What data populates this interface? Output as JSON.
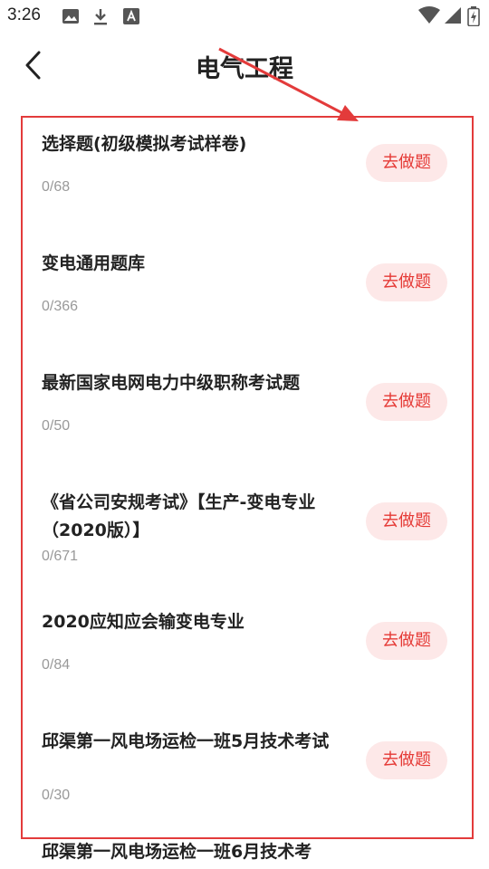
{
  "status_bar": {
    "time": "3:26",
    "icons": [
      "image-icon",
      "download-icon",
      "font-a-icon"
    ],
    "right_icons": [
      "wifi-icon",
      "signal-icon",
      "battery-icon"
    ]
  },
  "header": {
    "title": "电气工程",
    "back_icon": "chevron-left-icon"
  },
  "do_label": "去做题",
  "accent_color": "#e53935",
  "button_bg": "#fde8e8",
  "annotation_color": "#e33b3b",
  "items": [
    {
      "title": "选择题(初级模拟考试样卷)",
      "count": "0/68"
    },
    {
      "title": "变电通用题库",
      "count": "0/366"
    },
    {
      "title": "最新国家电网电力中级职称考试题",
      "count": "0/50"
    },
    {
      "title": "《省公司安规考试》【生产-变电专业（2020版）】",
      "count": "0/671"
    },
    {
      "title": "2020应知应会输变电专业",
      "count": "0/84"
    },
    {
      "title": "邱渠第一风电场运检一班5月技术考试",
      "count": "0/30"
    },
    {
      "title": "邱渠第一风电场运检一班6月技术考",
      "count": ""
    }
  ]
}
